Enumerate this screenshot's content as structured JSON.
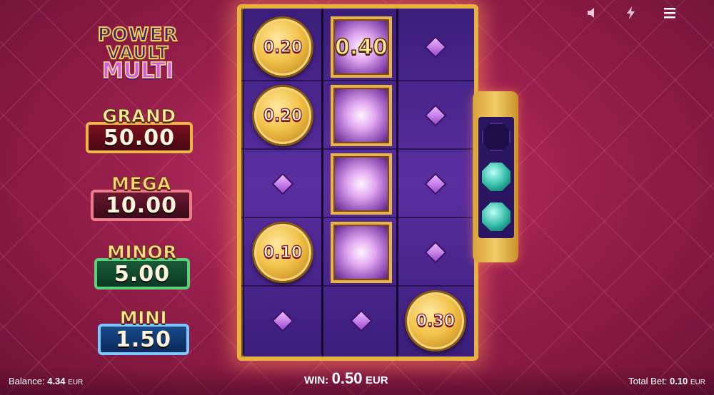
{
  "top_icons": [
    "speaker-icon",
    "lightning-icon",
    "menu-icon"
  ],
  "logo": {
    "line1": "POWER",
    "line2": "VAULT",
    "line3": "MULTI"
  },
  "jackpots": {
    "grand": {
      "name": "GRAND",
      "value": "50.00"
    },
    "mega": {
      "name": "MEGA",
      "value": "10.00"
    },
    "minor": {
      "name": "MINOR",
      "value": "5.00"
    },
    "mini": {
      "name": "MINI",
      "value": "1.50"
    }
  },
  "reels": {
    "reel1": [
      "0.20",
      "0.20",
      "",
      "0.10",
      ""
    ],
    "reel2": [
      "0.40",
      "",
      "",
      "",
      ""
    ],
    "reel3": [
      "",
      "",
      "",
      "",
      "0.30"
    ]
  },
  "colors": {
    "frame_gold": "#e6b13e",
    "background": "#9a1f4d",
    "reel_purple": "#5a2ea0"
  },
  "footer": {
    "balance_label": "Balance:",
    "balance_value": "4.34",
    "balance_currency": "EUR",
    "win_label": "WIN:",
    "win_value": "0.50",
    "win_currency": "EUR",
    "total_bet_label": "Total Bet:",
    "total_bet_value": "0.10",
    "total_bet_currency": "EUR"
  }
}
